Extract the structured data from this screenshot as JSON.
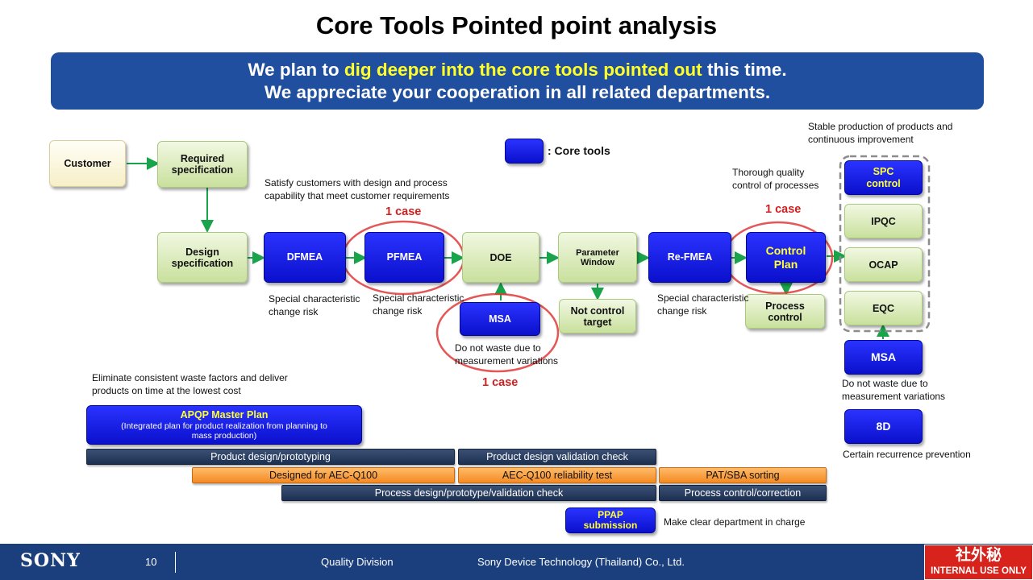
{
  "title": "Core Tools  Pointed point analysis",
  "banner": {
    "line1_pre": "We plan to ",
    "line1_highlight": "dig deeper into the core tools pointed out",
    "line1_post": " this time.",
    "line2": "We appreciate your cooperation in all related departments."
  },
  "legend": {
    "label": ": Core tools"
  },
  "flow": {
    "customer": "Customer",
    "required_spec": "Required specification",
    "design_spec": "Design specification",
    "dfmea": "DFMEA",
    "pfmea": "PFMEA",
    "doe": "DOE",
    "parameter_window": "Parameter Window",
    "refmea": "Re-FMEA",
    "control_plan": "Control Plan",
    "msa_mid": "MSA",
    "not_control": "Not control target",
    "process_control": "Process control",
    "spc": "SPC control",
    "ipqc": "IPQC",
    "ocap": "OCAP",
    "eqc": "EQC",
    "msa_right": "MSA",
    "eight_d": "8D",
    "apqp_title": "APQP  Master Plan",
    "apqp_sub": "(Integrated plan for product realization from planning to mass production)",
    "ppap": "PPAP submission"
  },
  "notes": {
    "satisfy": "Satisfy customers with design and process capability that meet customer requirements",
    "special1": "Special characteristic change risk",
    "special2": "Special characteristic change risk",
    "special3": "Special characteristic change risk",
    "waste_mid": "Do not waste due to measurement variations",
    "thorough": "Thorough quality control of processes",
    "stable": "Stable production of products and continuous improvement",
    "waste_right": "Do not waste due to measurement variations",
    "recurrence": "Certain recurrence prevention",
    "eliminate": "Eliminate consistent waste factors and deliver products on time at the lowest cost",
    "department": "Make clear department in charge"
  },
  "cases": {
    "pfmea": "1 case",
    "control_plan": "1 case",
    "msa": "1 case"
  },
  "bars": {
    "product_design": "Product design/prototyping",
    "product_validation": "Product design validation  check",
    "designed_aec": "Designed for AEC-Q100",
    "aec_test": "AEC-Q100 reliability test",
    "pat_sba": "PAT/SBA sorting",
    "process_design": "Process design/prototype/validation  check",
    "process_control": "Process control/correction"
  },
  "footer": {
    "logo": "SONY",
    "page": "10",
    "division": "Quality Division",
    "company": "Sony Device Technology (Thailand) Co., Ltd.",
    "badge_kanji": "社外秘",
    "badge_text": "INTERNAL USE ONLY"
  },
  "colors": {
    "core_tool": "#0b10cc",
    "banner": "#1f4f9e",
    "highlight": "#ffff2a",
    "case_red": "#d02020",
    "footer": "#1b3f7d"
  }
}
